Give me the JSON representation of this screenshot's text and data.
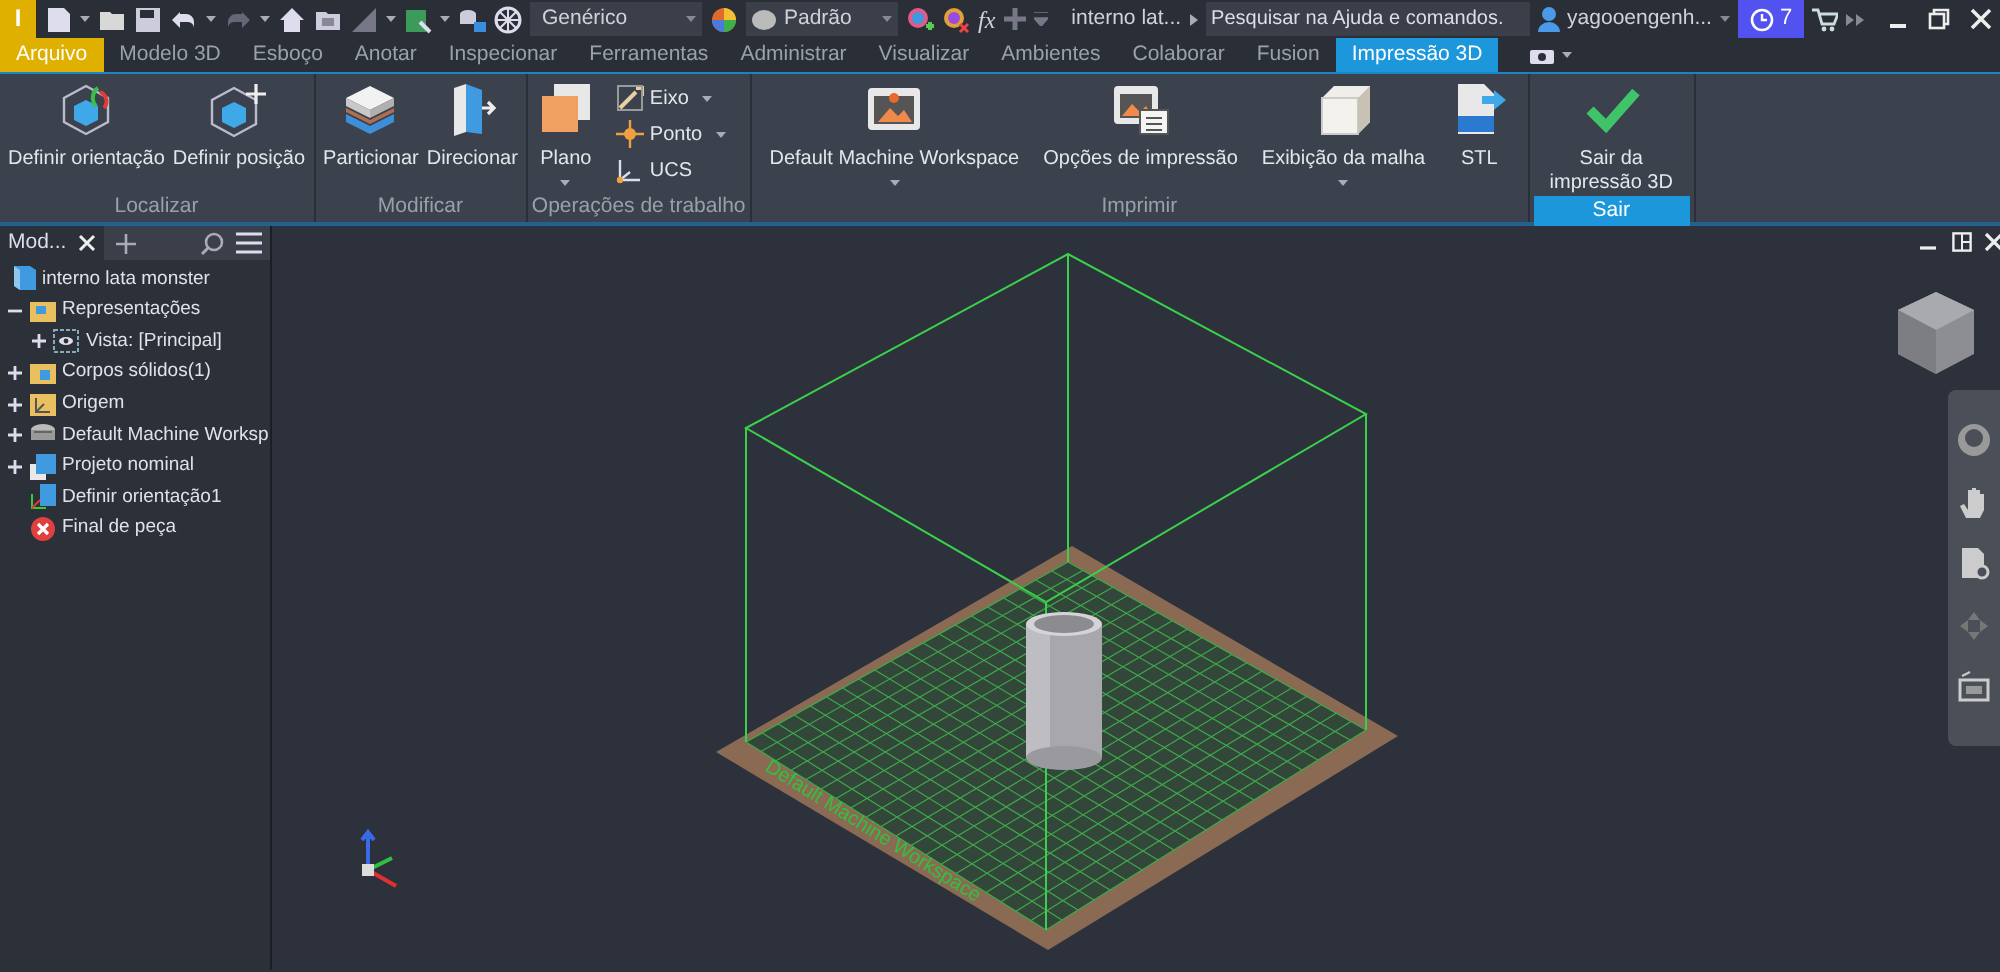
{
  "app_button": "I",
  "quick_access": {
    "style_select": "Genérico",
    "appearance_select": "Padrão",
    "function_button": "fx"
  },
  "document_title": "interno lat...",
  "search": {
    "placeholder": "Pesquisar na Ajuda e comandos."
  },
  "user": {
    "name": "yagooengenh..."
  },
  "notifications": {
    "count": "7"
  },
  "tabs": [
    {
      "label": "Arquivo",
      "kind": "file",
      "selected": false
    },
    {
      "label": "Modelo 3D",
      "selected": false
    },
    {
      "label": "Esboço",
      "selected": false
    },
    {
      "label": "Anotar",
      "selected": false
    },
    {
      "label": "Inspecionar",
      "selected": false
    },
    {
      "label": "Ferramentas",
      "selected": false
    },
    {
      "label": "Administrar",
      "selected": false
    },
    {
      "label": "Visualizar",
      "selected": false
    },
    {
      "label": "Ambientes",
      "selected": false
    },
    {
      "label": "Colaborar",
      "selected": false
    },
    {
      "label": "Fusion",
      "selected": false
    },
    {
      "label": "Impressão 3D",
      "selected": true
    }
  ],
  "ribbon": {
    "panels": [
      {
        "title": "Localizar",
        "highlighted": false,
        "buttons": [
          {
            "label": "Definir orientação",
            "kind": "large",
            "dropdown": false
          },
          {
            "label": "Definir posição",
            "kind": "large",
            "dropdown": false
          }
        ]
      },
      {
        "title": "Modificar",
        "highlighted": false,
        "buttons": [
          {
            "label": "Particionar",
            "kind": "large",
            "dropdown": false
          },
          {
            "label": "Direcionar",
            "kind": "large",
            "dropdown": false
          }
        ]
      },
      {
        "title": "Operações de trabalho",
        "highlighted": false,
        "buttons": [
          {
            "label": "Plano",
            "kind": "large",
            "dropdown": true
          },
          {
            "label": "Eixo",
            "kind": "small",
            "dropdown": true
          },
          {
            "label": "Ponto",
            "kind": "small",
            "dropdown": true
          },
          {
            "label": "UCS",
            "kind": "small",
            "dropdown": false
          }
        ]
      },
      {
        "title": "Imprimir",
        "highlighted": false,
        "buttons": [
          {
            "label": "Default Machine Workspace",
            "kind": "large",
            "dropdown": true
          },
          {
            "label": "Opções de impressão",
            "kind": "large",
            "dropdown": false
          },
          {
            "label": "Exibição da malha",
            "kind": "large",
            "dropdown": true
          },
          {
            "label": "STL",
            "kind": "large",
            "dropdown": false
          }
        ]
      },
      {
        "title": "Sair",
        "highlighted": true,
        "buttons": [
          {
            "label": "Sair da impressão 3D",
            "kind": "large",
            "dropdown": false
          }
        ]
      }
    ]
  },
  "browser": {
    "tab": "Mod...",
    "tree": [
      {
        "label": "interno lata monster",
        "children": [
          {
            "label": "Representações",
            "expanded": true,
            "children": [
              {
                "label": "Vista: [Principal]",
                "expanded": false
              }
            ]
          },
          {
            "label": "Corpos sólidos(1)",
            "expanded": false
          },
          {
            "label": "Origem",
            "expanded": false
          },
          {
            "label": "Default Machine Worksp",
            "expanded": false
          },
          {
            "label": "Projeto nominal",
            "expanded": false
          },
          {
            "label": "Definir orientação1"
          },
          {
            "label": "Final de peça"
          }
        ]
      }
    ]
  },
  "viewport": {
    "plate_label": "Default Machine Workspace"
  }
}
